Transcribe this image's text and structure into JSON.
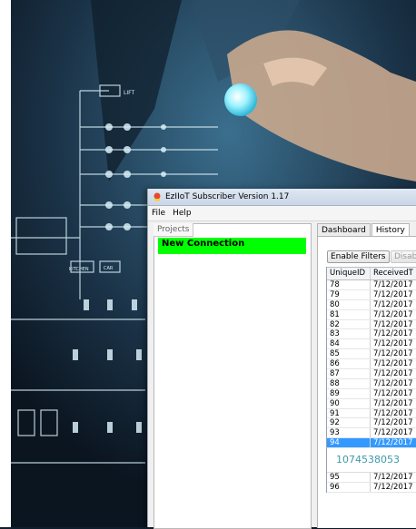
{
  "window": {
    "title": "EzIIoT Subscriber  Version 1.17",
    "menu": [
      "File",
      "Help"
    ]
  },
  "projects": {
    "tab_label": "Projects",
    "items": [
      "New Connection"
    ]
  },
  "tabs": [
    "Dashboard",
    "History"
  ],
  "buttons": {
    "enable_filters": "Enable Filters",
    "disable_partial": "Disab"
  },
  "history_table": {
    "columns": [
      "UniqueID",
      "ReceivedT"
    ],
    "rows": [
      {
        "id": "78",
        "received": "7/12/2017"
      },
      {
        "id": "79",
        "received": "7/12/2017"
      },
      {
        "id": "80",
        "received": "7/12/2017"
      },
      {
        "id": "81",
        "received": "7/12/2017"
      },
      {
        "id": "82",
        "received": "7/12/2017"
      },
      {
        "id": "83",
        "received": "7/12/2017"
      },
      {
        "id": "84",
        "received": "7/12/2017"
      },
      {
        "id": "85",
        "received": "7/12/2017"
      },
      {
        "id": "86",
        "received": "7/12/2017"
      },
      {
        "id": "87",
        "received": "7/12/2017"
      },
      {
        "id": "88",
        "received": "7/12/2017"
      },
      {
        "id": "89",
        "received": "7/12/2017"
      },
      {
        "id": "90",
        "received": "7/12/2017"
      },
      {
        "id": "91",
        "received": "7/12/2017"
      },
      {
        "id": "92",
        "received": "7/12/2017"
      },
      {
        "id": "93",
        "received": "7/12/2017"
      },
      {
        "id": "94",
        "received": "7/12/2017"
      }
    ],
    "selected_detail": "1074538053",
    "rows_after": [
      {
        "id": "95",
        "received": "7/12/2017"
      },
      {
        "id": "96",
        "received": "7/12/2017"
      }
    ]
  },
  "background_labels": [
    "LIFT",
    "KITCHEN",
    "CAR"
  ],
  "colors": {
    "accent_green": "#00ff00",
    "selection_blue": "#3399ff",
    "detail_text": "#3e9aa6"
  }
}
